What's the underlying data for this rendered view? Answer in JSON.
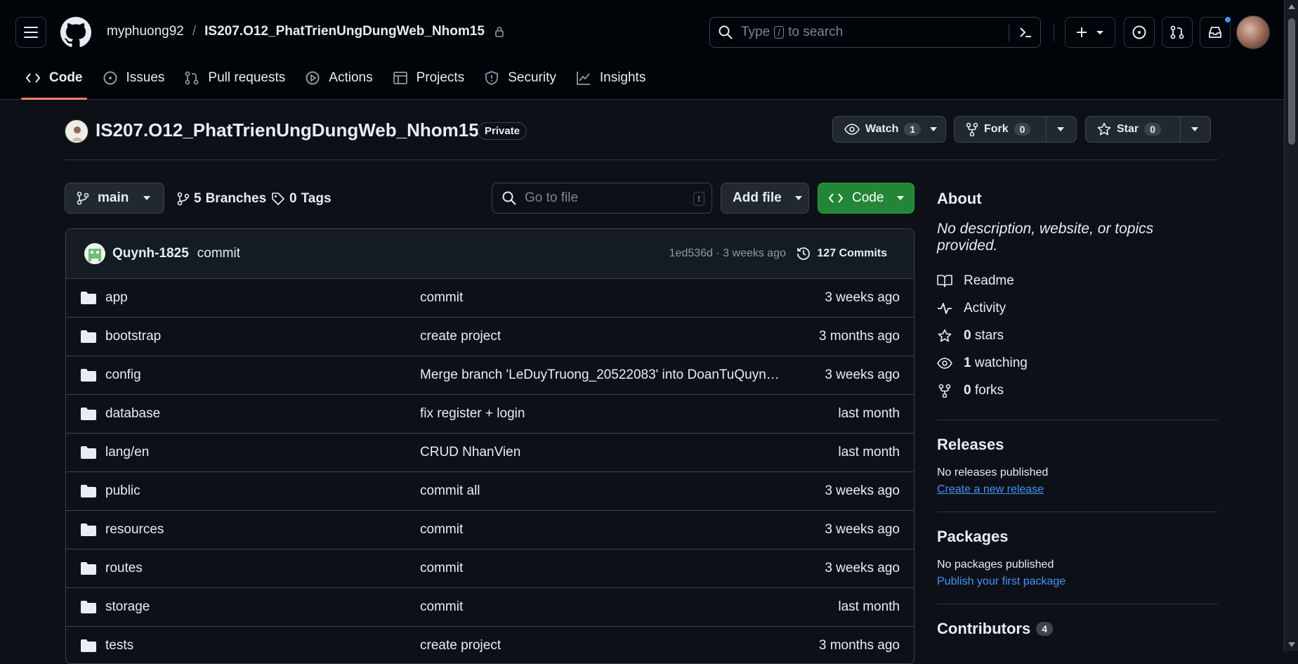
{
  "header": {
    "owner": "myphuong92",
    "separator": "/",
    "repo": "IS207.O12_PhatTrienUngDungWeb_Nhom15",
    "search_prefix": "Type",
    "search_key": "/",
    "search_suffix": "to search"
  },
  "tabs": [
    {
      "label": "Code",
      "icon": "code-icon"
    },
    {
      "label": "Issues",
      "icon": "issue-icon"
    },
    {
      "label": "Pull requests",
      "icon": "pull-request-icon"
    },
    {
      "label": "Actions",
      "icon": "play-icon"
    },
    {
      "label": "Projects",
      "icon": "table-icon"
    },
    {
      "label": "Security",
      "icon": "shield-icon"
    },
    {
      "label": "Insights",
      "icon": "graph-icon"
    }
  ],
  "repo": {
    "name": "IS207.O12_PhatTrienUngDungWeb_Nhom15",
    "visibility": "Private",
    "watch_label": "Watch",
    "watch_count": "1",
    "fork_label": "Fork",
    "fork_count": "0",
    "star_label": "Star",
    "star_count": "0"
  },
  "toolbar": {
    "branch": "main",
    "branches_count": "5",
    "branches_label": "Branches",
    "tags_count": "0",
    "tags_label": "Tags",
    "gofile_placeholder": "Go to file",
    "gofile_key": "t",
    "addfile_label": "Add file",
    "code_label": "Code"
  },
  "latest_commit": {
    "author": "Quynh-1825",
    "message": "commit",
    "hash_time": "1ed536d · 3 weeks ago",
    "commits_label": "127 Commits"
  },
  "files": [
    {
      "name": "app",
      "message": "commit",
      "date": "3 weeks ago"
    },
    {
      "name": "bootstrap",
      "message": "create project",
      "date": "3 months ago"
    },
    {
      "name": "config",
      "message": "Merge branch 'LeDuyTruong_20522083' into DoanTuQuynh_…",
      "date": "3 weeks ago"
    },
    {
      "name": "database",
      "message": "fix register + login",
      "date": "last month"
    },
    {
      "name": "lang/en",
      "message": "CRUD NhanVien",
      "date": "last month"
    },
    {
      "name": "public",
      "message": "commit all",
      "date": "3 weeks ago"
    },
    {
      "name": "resources",
      "message": "commit",
      "date": "3 weeks ago"
    },
    {
      "name": "routes",
      "message": "commit",
      "date": "3 weeks ago"
    },
    {
      "name": "storage",
      "message": "commit",
      "date": "last month"
    },
    {
      "name": "tests",
      "message": "create project",
      "date": "3 months ago"
    }
  ],
  "about": {
    "title": "About",
    "description": "No description, website, or topics provided.",
    "readme": "Readme",
    "activity": "Activity",
    "stars_count": "0",
    "stars_label": "stars",
    "watching_count": "1",
    "watching_label": "watching",
    "forks_count": "0",
    "forks_label": "forks"
  },
  "releases": {
    "title": "Releases",
    "none": "No releases published",
    "link": "Create a new release"
  },
  "packages": {
    "title": "Packages",
    "none": "No packages published",
    "link": "Publish your first package"
  },
  "contributors": {
    "title": "Contributors",
    "count": "4"
  },
  "colors": {
    "background": "#0d1117",
    "header": "#010409",
    "accent_tab": "#f78166",
    "code_button": "#238636",
    "link": "#4493f8"
  }
}
